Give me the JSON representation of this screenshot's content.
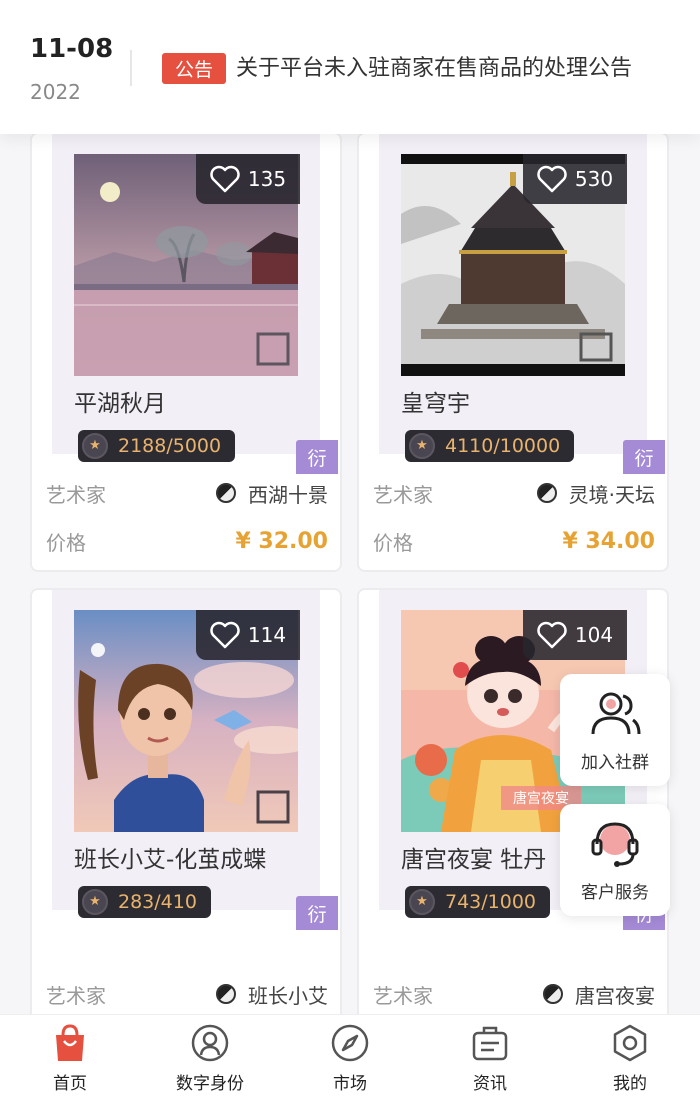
{
  "header": {
    "date_day": "11-08",
    "date_year": "2022",
    "notice_tag": "公告",
    "notice_text": "关于平台未入驻商家在售商品的处理公告"
  },
  "cards": [
    {
      "likes": "135",
      "title": "平湖秋月",
      "stock": "2188/5000",
      "badge": "衍",
      "artist_label": "艺术家",
      "artist_name": "西湖十景",
      "price_label": "价格",
      "price": "¥ 32.00"
    },
    {
      "likes": "530",
      "title": "皇穹宇",
      "stock": "4110/10000",
      "badge": "衍",
      "artist_label": "艺术家",
      "artist_name": "灵境·天坛",
      "price_label": "价格",
      "price": "¥ 34.00"
    },
    {
      "likes": "114",
      "title": "班长小艾-化茧成蝶",
      "stock": "283/410",
      "badge": "衍",
      "artist_label": "艺术家",
      "artist_name": "班长小艾"
    },
    {
      "likes": "104",
      "title": "唐宫夜宴 牡丹",
      "stock": "743/1000",
      "badge": "衍",
      "artist_label": "艺术家",
      "artist_name": "唐宫夜宴"
    }
  ],
  "float_buttons": {
    "community": "加入社群",
    "service": "客户服务"
  },
  "bottom_nav": [
    {
      "label": "首页",
      "icon": "shopping-bag-icon",
      "active": true
    },
    {
      "label": "数字身份",
      "icon": "user-circle-icon",
      "active": false
    },
    {
      "label": "市场",
      "icon": "compass-icon",
      "active": false
    },
    {
      "label": "资讯",
      "icon": "news-icon",
      "active": false
    },
    {
      "label": "我的",
      "icon": "hexagon-icon",
      "active": false
    }
  ],
  "colors": {
    "accent_red": "#e5503f",
    "price_gold": "#e6a233",
    "badge_purple": "#a58ad6"
  }
}
